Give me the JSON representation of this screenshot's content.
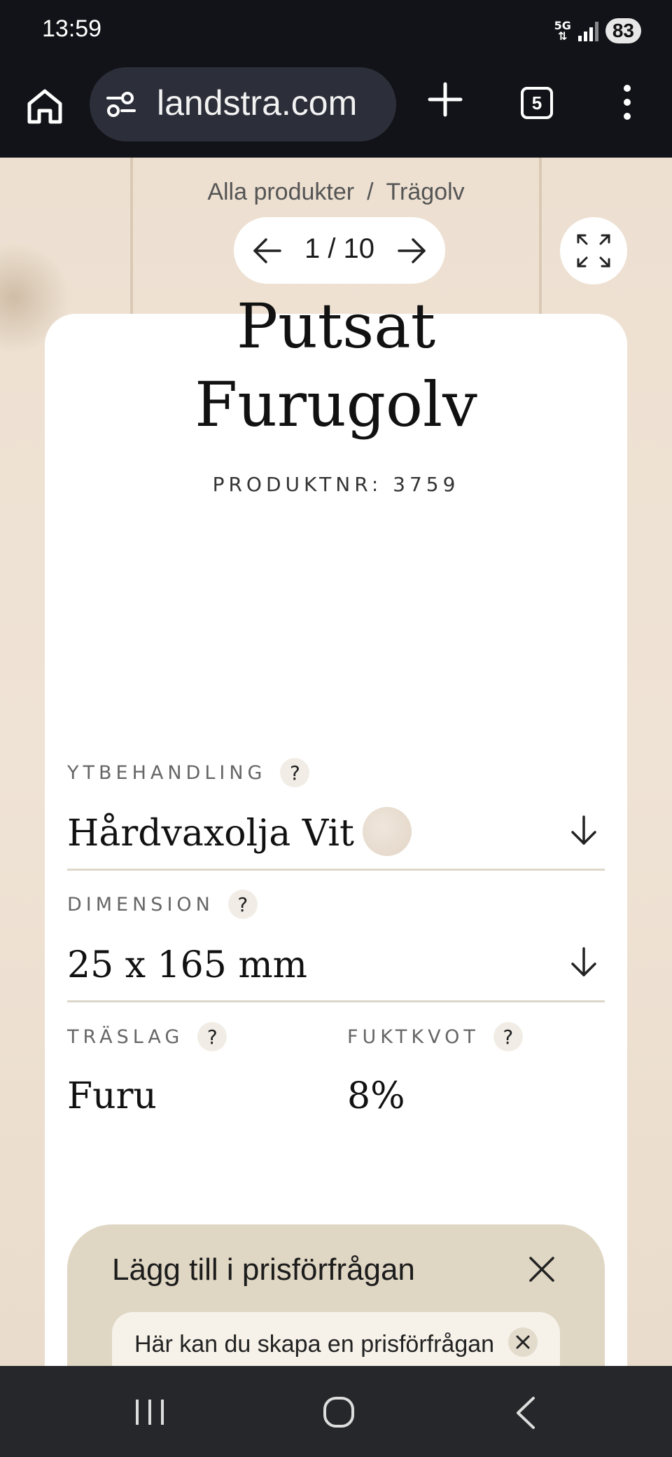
{
  "status_bar": {
    "time": "13:59",
    "network": "5G",
    "battery": "83"
  },
  "browser": {
    "url": "landstra.com",
    "tab_count": "5"
  },
  "gallery": {
    "counter": "1 / 10"
  },
  "breadcrumb": {
    "items": [
      "Alla produkter",
      "Trägolv"
    ],
    "separator": "/"
  },
  "product": {
    "title_line1": "Putsat",
    "title_line2": "Furugolv",
    "product_number": "PRODUKTNR: 3759"
  },
  "fields": {
    "ytbehandling": {
      "label": "YTBEHANDLING",
      "value": "Hårdvaxolja Vit",
      "help": "?"
    },
    "dimension": {
      "label": "DIMENSION",
      "value": "25 x 165 mm",
      "help": "?"
    },
    "traslag": {
      "label": "TRÄSLAG",
      "value": "Furu",
      "help": "?"
    },
    "fuktkvot": {
      "label": "FUKTKVOT",
      "value": "8%",
      "help": "?"
    }
  },
  "request_panel": {
    "title": "Lägg till i prisförfrågan",
    "info_text": "Här kan du skapa en prisförfrågan"
  },
  "colors": {
    "accent_panel": "#dfd6c3",
    "background": "#ede0d1"
  }
}
